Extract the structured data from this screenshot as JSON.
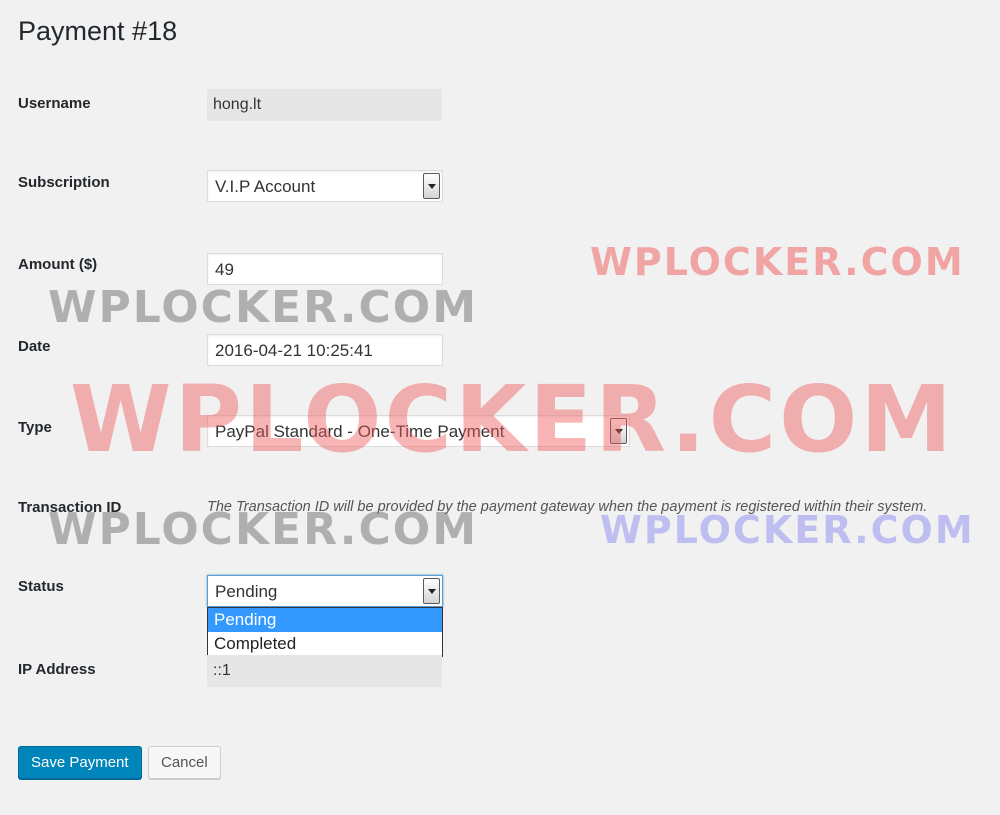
{
  "page": {
    "title": "Payment #18"
  },
  "fields": {
    "username": {
      "label": "Username",
      "value": "hong.lt"
    },
    "subscription": {
      "label": "Subscription",
      "value": "V.I.P Account"
    },
    "amount": {
      "label": "Amount ($)",
      "value": "49"
    },
    "date": {
      "label": "Date",
      "value": "2016-04-21 10:25:41"
    },
    "type": {
      "label": "Type",
      "value": "PayPal Standard - One-Time Payment"
    },
    "transaction_id": {
      "label": "Transaction ID",
      "description": "The Transaction ID will be provided by the payment gateway when the payment is registered within their system."
    },
    "status": {
      "label": "Status",
      "value": "Pending",
      "options": [
        "Pending",
        "Completed"
      ]
    },
    "ip_address": {
      "label": "IP Address",
      "value": "::1"
    }
  },
  "buttons": {
    "save": "Save Payment",
    "cancel": "Cancel"
  },
  "watermarks": {
    "gray_1": "WPLOCKER.COM",
    "red_small": "WPLOCKER.COM",
    "red_large": "WPLOCKER.COM",
    "gray_2": "WPLOCKER.COM",
    "blue": "WPLOCKER.COM"
  },
  "colors": {
    "primary_button": "#0085ba",
    "selected_option": "#3399ff",
    "background": "#f1f1f1"
  }
}
